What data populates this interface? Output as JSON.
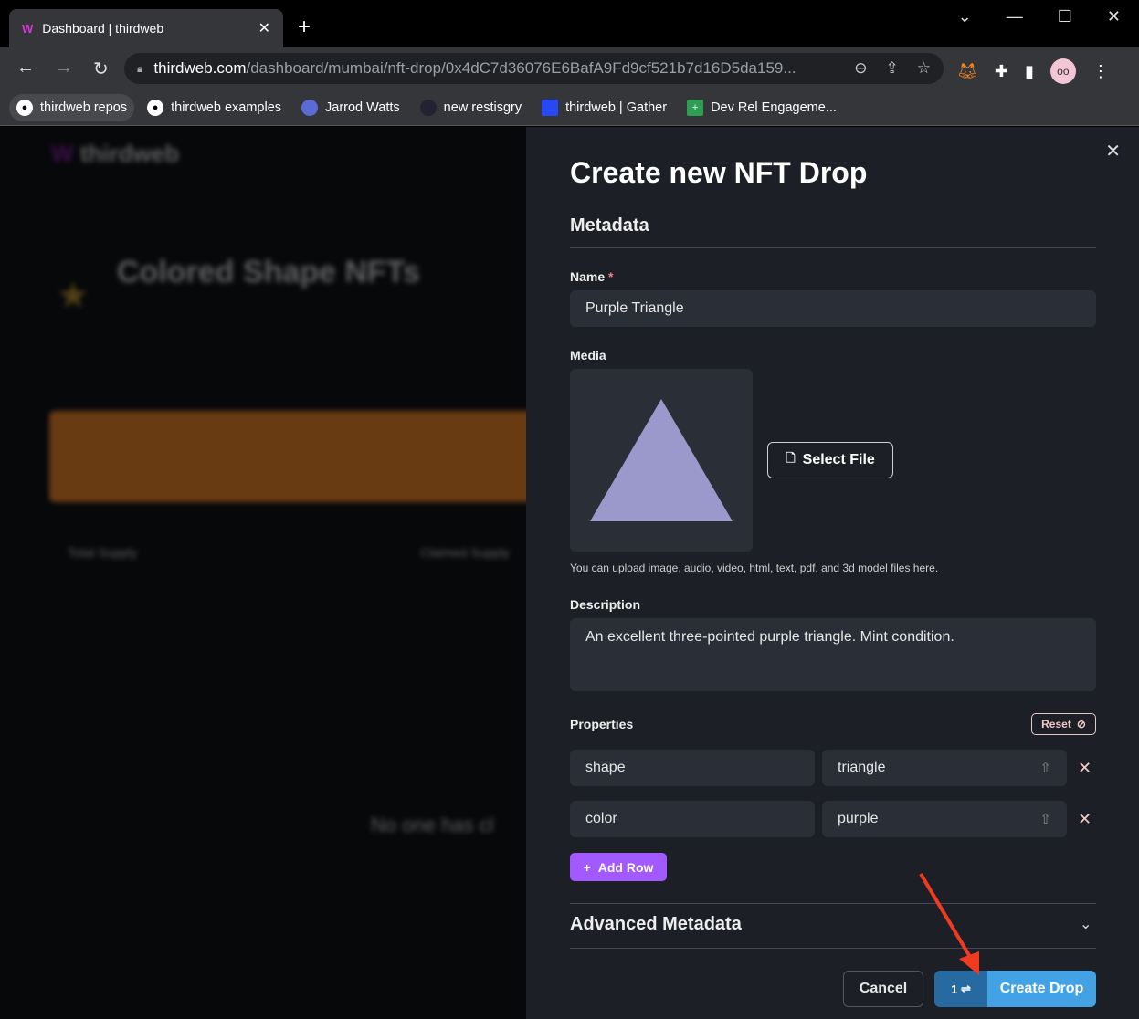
{
  "browser": {
    "tab_title": "Dashboard | thirdweb",
    "url_host": "thirdweb.com",
    "url_path": "/dashboard/mumbai/nft-drop/0x4dC7d36076E6BafA9Fd9cf521b7d16D5da159...",
    "bookmarks": [
      {
        "label": "thirdweb repos",
        "icon": "github-icon"
      },
      {
        "label": "thirdweb examples",
        "icon": "github-icon"
      },
      {
        "label": "Jarrod Watts",
        "icon": "globe-icon"
      },
      {
        "label": "new restisgry",
        "icon": "moon-icon"
      },
      {
        "label": "thirdweb | Gather",
        "icon": "gather-icon"
      },
      {
        "label": "Dev Rel Engageme...",
        "icon": "sheets-icon"
      }
    ]
  },
  "background": {
    "logo": "thirdweb",
    "title": "Colored Shape NFTs",
    "stats": [
      "Total Supply",
      "Claimed Supply"
    ],
    "empty": "No one has cl"
  },
  "drawer": {
    "title": "Create new NFT Drop",
    "metadata_heading": "Metadata",
    "name_label": "Name",
    "required_mark": "*",
    "name_value": "Purple Triangle",
    "media_label": "Media",
    "select_file": "Select File",
    "media_hint": "You can upload image, audio, video, html, text, pdf, and 3d model files here.",
    "description_label": "Description",
    "description_value": "An excellent three-pointed purple triangle. Mint condition.",
    "properties_label": "Properties",
    "reset": "Reset",
    "properties": [
      {
        "key": "shape",
        "value": "triangle"
      },
      {
        "key": "color",
        "value": "purple"
      }
    ],
    "add_row": "Add Row",
    "advanced": "Advanced Metadata",
    "cancel": "Cancel",
    "tx_count": "1",
    "create": "Create Drop"
  },
  "colors": {
    "accent": "#42a2e4",
    "purple": "#a259ff",
    "triangle": "#9b98cc",
    "annotation_arrow": "#f03a22"
  }
}
